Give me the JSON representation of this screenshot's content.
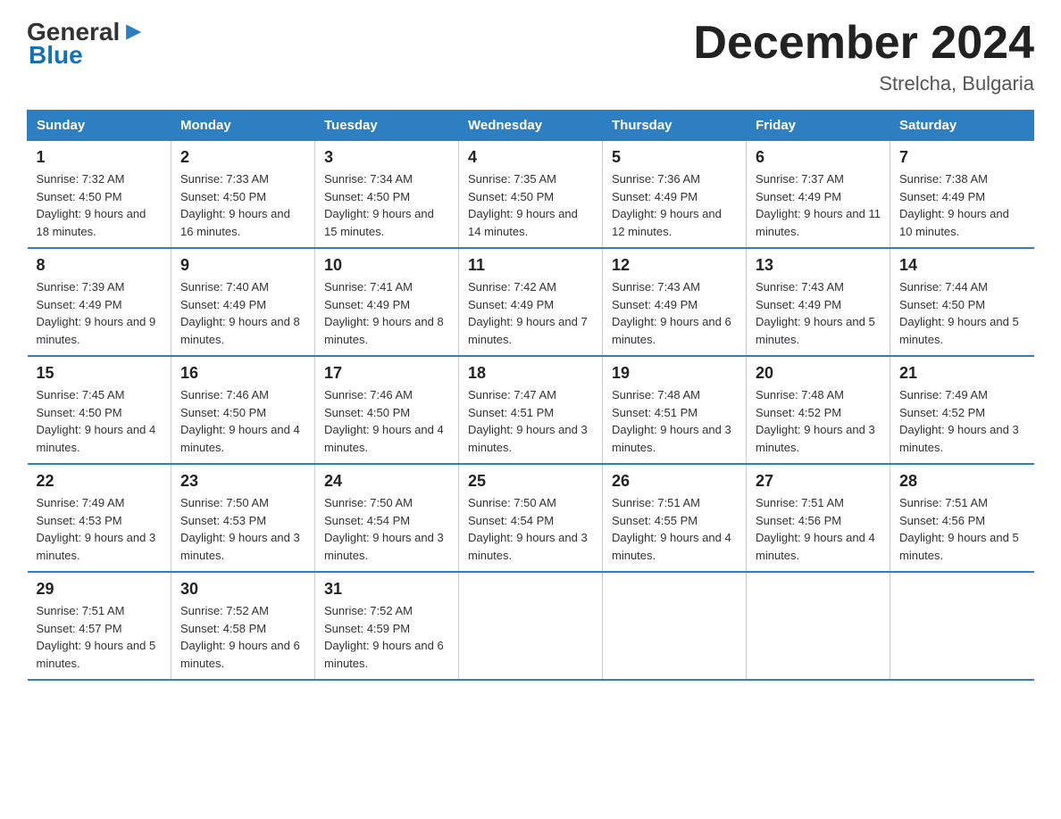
{
  "logo": {
    "text_general": "General",
    "text_blue": "Blue"
  },
  "header": {
    "month": "December 2024",
    "location": "Strelcha, Bulgaria"
  },
  "days_of_week": [
    "Sunday",
    "Monday",
    "Tuesday",
    "Wednesday",
    "Thursday",
    "Friday",
    "Saturday"
  ],
  "weeks": [
    [
      {
        "day": "1",
        "sunrise": "7:32 AM",
        "sunset": "4:50 PM",
        "daylight": "9 hours and 18 minutes."
      },
      {
        "day": "2",
        "sunrise": "7:33 AM",
        "sunset": "4:50 PM",
        "daylight": "9 hours and 16 minutes."
      },
      {
        "day": "3",
        "sunrise": "7:34 AM",
        "sunset": "4:50 PM",
        "daylight": "9 hours and 15 minutes."
      },
      {
        "day": "4",
        "sunrise": "7:35 AM",
        "sunset": "4:50 PM",
        "daylight": "9 hours and 14 minutes."
      },
      {
        "day": "5",
        "sunrise": "7:36 AM",
        "sunset": "4:49 PM",
        "daylight": "9 hours and 12 minutes."
      },
      {
        "day": "6",
        "sunrise": "7:37 AM",
        "sunset": "4:49 PM",
        "daylight": "9 hours and 11 minutes."
      },
      {
        "day": "7",
        "sunrise": "7:38 AM",
        "sunset": "4:49 PM",
        "daylight": "9 hours and 10 minutes."
      }
    ],
    [
      {
        "day": "8",
        "sunrise": "7:39 AM",
        "sunset": "4:49 PM",
        "daylight": "9 hours and 9 minutes."
      },
      {
        "day": "9",
        "sunrise": "7:40 AM",
        "sunset": "4:49 PM",
        "daylight": "9 hours and 8 minutes."
      },
      {
        "day": "10",
        "sunrise": "7:41 AM",
        "sunset": "4:49 PM",
        "daylight": "9 hours and 8 minutes."
      },
      {
        "day": "11",
        "sunrise": "7:42 AM",
        "sunset": "4:49 PM",
        "daylight": "9 hours and 7 minutes."
      },
      {
        "day": "12",
        "sunrise": "7:43 AM",
        "sunset": "4:49 PM",
        "daylight": "9 hours and 6 minutes."
      },
      {
        "day": "13",
        "sunrise": "7:43 AM",
        "sunset": "4:49 PM",
        "daylight": "9 hours and 5 minutes."
      },
      {
        "day": "14",
        "sunrise": "7:44 AM",
        "sunset": "4:50 PM",
        "daylight": "9 hours and 5 minutes."
      }
    ],
    [
      {
        "day": "15",
        "sunrise": "7:45 AM",
        "sunset": "4:50 PM",
        "daylight": "9 hours and 4 minutes."
      },
      {
        "day": "16",
        "sunrise": "7:46 AM",
        "sunset": "4:50 PM",
        "daylight": "9 hours and 4 minutes."
      },
      {
        "day": "17",
        "sunrise": "7:46 AM",
        "sunset": "4:50 PM",
        "daylight": "9 hours and 4 minutes."
      },
      {
        "day": "18",
        "sunrise": "7:47 AM",
        "sunset": "4:51 PM",
        "daylight": "9 hours and 3 minutes."
      },
      {
        "day": "19",
        "sunrise": "7:48 AM",
        "sunset": "4:51 PM",
        "daylight": "9 hours and 3 minutes."
      },
      {
        "day": "20",
        "sunrise": "7:48 AM",
        "sunset": "4:52 PM",
        "daylight": "9 hours and 3 minutes."
      },
      {
        "day": "21",
        "sunrise": "7:49 AM",
        "sunset": "4:52 PM",
        "daylight": "9 hours and 3 minutes."
      }
    ],
    [
      {
        "day": "22",
        "sunrise": "7:49 AM",
        "sunset": "4:53 PM",
        "daylight": "9 hours and 3 minutes."
      },
      {
        "day": "23",
        "sunrise": "7:50 AM",
        "sunset": "4:53 PM",
        "daylight": "9 hours and 3 minutes."
      },
      {
        "day": "24",
        "sunrise": "7:50 AM",
        "sunset": "4:54 PM",
        "daylight": "9 hours and 3 minutes."
      },
      {
        "day": "25",
        "sunrise": "7:50 AM",
        "sunset": "4:54 PM",
        "daylight": "9 hours and 3 minutes."
      },
      {
        "day": "26",
        "sunrise": "7:51 AM",
        "sunset": "4:55 PM",
        "daylight": "9 hours and 4 minutes."
      },
      {
        "day": "27",
        "sunrise": "7:51 AM",
        "sunset": "4:56 PM",
        "daylight": "9 hours and 4 minutes."
      },
      {
        "day": "28",
        "sunrise": "7:51 AM",
        "sunset": "4:56 PM",
        "daylight": "9 hours and 5 minutes."
      }
    ],
    [
      {
        "day": "29",
        "sunrise": "7:51 AM",
        "sunset": "4:57 PM",
        "daylight": "9 hours and 5 minutes."
      },
      {
        "day": "30",
        "sunrise": "7:52 AM",
        "sunset": "4:58 PM",
        "daylight": "9 hours and 6 minutes."
      },
      {
        "day": "31",
        "sunrise": "7:52 AM",
        "sunset": "4:59 PM",
        "daylight": "9 hours and 6 minutes."
      },
      null,
      null,
      null,
      null
    ]
  ],
  "labels": {
    "sunrise": "Sunrise:",
    "sunset": "Sunset:",
    "daylight": "Daylight:"
  }
}
